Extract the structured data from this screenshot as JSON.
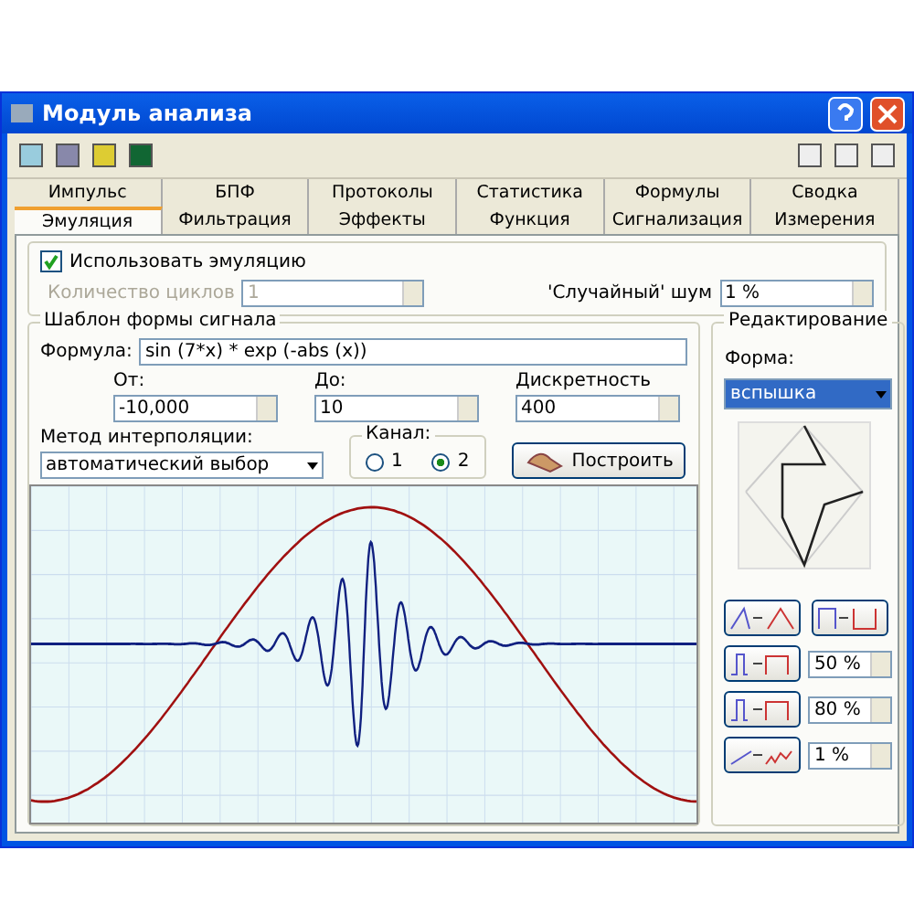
{
  "window": {
    "title": "Модуль анализа"
  },
  "tabs_back": [
    {
      "label": "Импульс",
      "selected": false
    },
    {
      "label": "БПФ",
      "selected": false
    },
    {
      "label": "Протоколы",
      "selected": false
    },
    {
      "label": "Статистика",
      "selected": false
    },
    {
      "label": "Формулы",
      "selected": false
    },
    {
      "label": "Сводка",
      "selected": false
    }
  ],
  "tabs_front": [
    {
      "label": "Эмуляция",
      "selected": true
    },
    {
      "label": "Фильтрация",
      "selected": false
    },
    {
      "label": "Эффекты",
      "selected": false
    },
    {
      "label": "Функция",
      "selected": false
    },
    {
      "label": "Сигнализация",
      "selected": false
    },
    {
      "label": "Измерения",
      "selected": false
    }
  ],
  "emulation": {
    "label": "Использовать эмуляцию",
    "checked": true,
    "cycles_label": "Количество циклов",
    "cycles_value": "1",
    "cycles_disabled": true,
    "noise_label": "'Случайный' шум",
    "noise_value": "1 %"
  },
  "template": {
    "title": "Шаблон формы сигнала",
    "formula_label": "Формула:",
    "formula": "sin (7*x) * exp (-abs (x))",
    "from_label": "От:",
    "from": "-10,000",
    "to_label": "До:",
    "to": "10",
    "step_label": "Дискретность",
    "step": "400",
    "interp_label": "Метод интерполяции:",
    "interp": "автоматический выбор",
    "channel_label": "Канал:",
    "channels": [
      {
        "label": "1",
        "selected": false
      },
      {
        "label": "2",
        "selected": true
      }
    ],
    "build_button": "Построить"
  },
  "editing": {
    "title": "Редактирование",
    "shape_label": "Форма:",
    "shape": "вспышка",
    "spins": [
      "50 %",
      "80 %",
      "1 %"
    ]
  }
}
